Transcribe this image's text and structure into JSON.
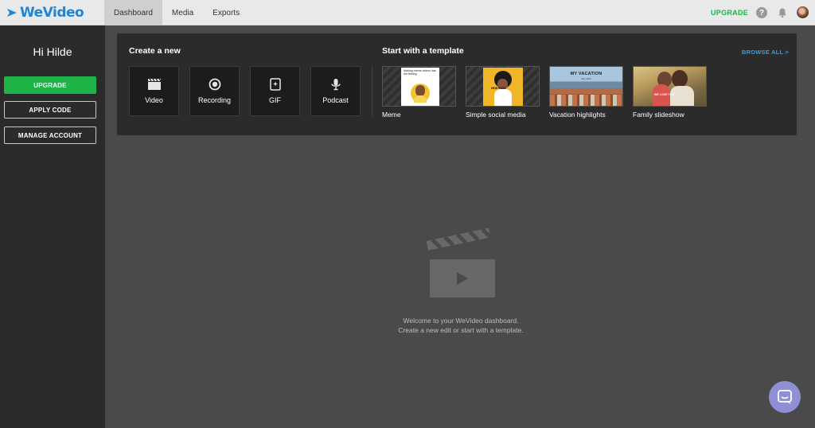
{
  "app": {
    "logo_text": "WeVideo",
    "brand_color": "#1f85d6",
    "accent_green": "#1fb447"
  },
  "nav": {
    "tabs": [
      {
        "label": "Dashboard",
        "active": true
      },
      {
        "label": "Media",
        "active": false
      },
      {
        "label": "Exports",
        "active": false
      }
    ],
    "upgrade_label": "UPGRADE",
    "help_label": "?"
  },
  "sidebar": {
    "greeting": "Hi Hilde",
    "upgrade_label": "UPGRADE",
    "apply_code_label": "APPLY CODE",
    "manage_account_label": "MANAGE ACCOUNT"
  },
  "create": {
    "heading": "Create a new",
    "tiles": [
      {
        "label": "Video",
        "icon": "film-icon"
      },
      {
        "label": "Recording",
        "icon": "record-icon"
      },
      {
        "label": "GIF",
        "icon": "gif-icon"
      },
      {
        "label": "Podcast",
        "icon": "microphone-icon"
      }
    ]
  },
  "templates": {
    "heading": "Start with a template",
    "browse_all_label": "BROWSE ALL >",
    "items": [
      {
        "label": "Meme",
        "thumb_text": "Making meme videos has me feeling"
      },
      {
        "label": "Simple social media",
        "thumb_text": "NEW POST"
      },
      {
        "label": "Vacation highlights",
        "thumb_text": "MY VACATION",
        "thumb_subtext": "Italy 2020"
      },
      {
        "label": "Family slideshow",
        "thumb_text": "WE LOVE YOU"
      }
    ]
  },
  "empty_state": {
    "line1": "Welcome to your WeVideo dashboard.",
    "line2": "Create a new edit or start with a template."
  }
}
